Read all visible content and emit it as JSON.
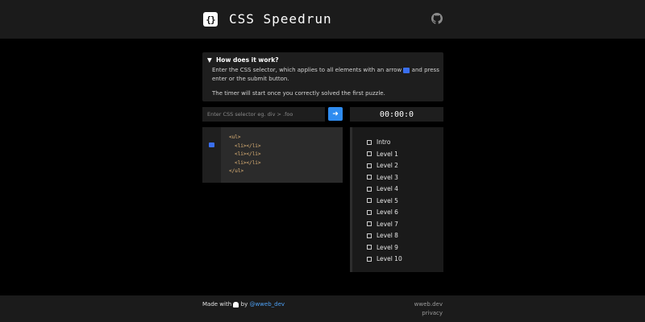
{
  "header": {
    "logo_glyph": "{}",
    "title": "CSS Speedrun",
    "github_icon": "github-icon"
  },
  "help": {
    "summary": "How does it work?",
    "text_before_arrow": "Enter the CSS selector, which applies to all elements with an arrow",
    "text_after_arrow": "and press enter or the submit button.",
    "timer_note": "The timer will start once you correctly solved the first puzzle."
  },
  "input": {
    "placeholder": "Enter CSS selector eg. div > .foo",
    "value": ""
  },
  "submit": {
    "icon": "arrow-right-icon",
    "glyph": "➜"
  },
  "timer": {
    "value": "00:00:0"
  },
  "code": {
    "lines": [
      {
        "indent": "",
        "tag": "<ul>"
      },
      {
        "indent": "  ",
        "tag": "<li></li>"
      },
      {
        "indent": "  ",
        "tag": "<li></li>"
      },
      {
        "indent": "  ",
        "tag": "<li></li>"
      },
      {
        "indent": "",
        "tag": "</ul>"
      }
    ]
  },
  "levels": [
    "Intro",
    "Level 1",
    "Level 2",
    "Level 3",
    "Level 4",
    "Level 5",
    "Level 6",
    "Level 7",
    "Level 8",
    "Level 9",
    "Level 10"
  ],
  "footer": {
    "made_with": "Made with",
    "by": "by",
    "author": "@wweb_dev",
    "site": "wweb.dev",
    "privacy": "privacy"
  },
  "colors": {
    "accent": "#2f8cf0",
    "arrow_marker": "#3a6ff0",
    "background": "#000000",
    "panel": "#1e1e1e"
  }
}
